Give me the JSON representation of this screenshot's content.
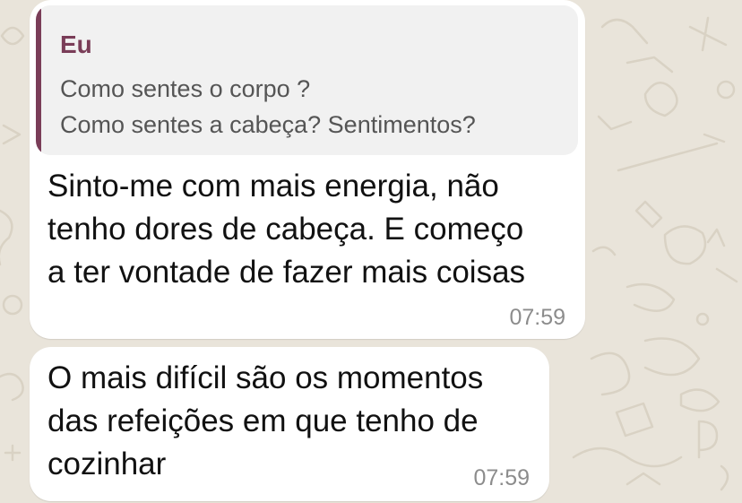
{
  "chat": {
    "background_color": "#e9e4da",
    "bubble_color": "#ffffff",
    "messages": [
      {
        "reply": {
          "author": "Eu",
          "author_color": "#7a3d58",
          "lines": [
            "Como sentes o corpo ?",
            "Como sentes a cabeça? Sentimentos?"
          ]
        },
        "lines": [
          "Sinto-me com mais energia, não",
          "tenho dores de cabeça. E começo",
          "a ter vontade de fazer mais coisas"
        ],
        "time": "07:59"
      },
      {
        "lines": [
          "O mais difícil são os momentos",
          "das refeições em que tenho de",
          "cozinhar"
        ],
        "time": "07:59"
      }
    ]
  }
}
